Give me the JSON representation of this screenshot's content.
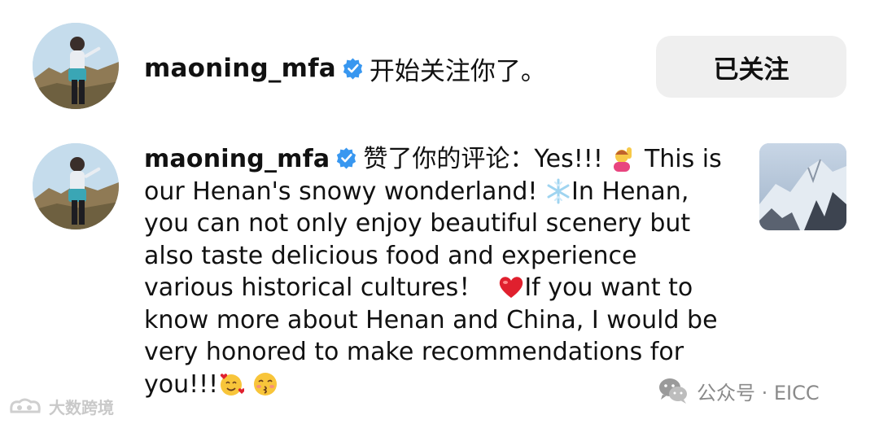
{
  "notifications": [
    {
      "username": "maoning_mfa",
      "action": "开始关注你了。",
      "button_label": "已关注"
    },
    {
      "username": "maoning_mfa",
      "action_prefix": "赞了你的评论：",
      "comment": {
        "seg1": "Yes!!!",
        "seg2": "This is our Henan's snowy wonderland!",
        "seg3": "In Henan, you can not only enjoy beautiful scenery but also taste delicious food and experience various historical cultures！",
        "seg4": "If you want to know more about Henan and China, I would be very honored to make recommendations for you!!!"
      },
      "emoji_names": [
        "person-raising-hand-icon",
        "snowflake-icon",
        "red-heart-icon",
        "smiling-face-with-hearts-icon",
        "kissing-face-icon"
      ]
    }
  ],
  "watermarks": {
    "left": "大数跨境",
    "right": "公众号 · EICC"
  },
  "colors": {
    "verified_blue": "#3897f0",
    "button_bg": "#efefef",
    "heart_red": "#e0202e"
  }
}
